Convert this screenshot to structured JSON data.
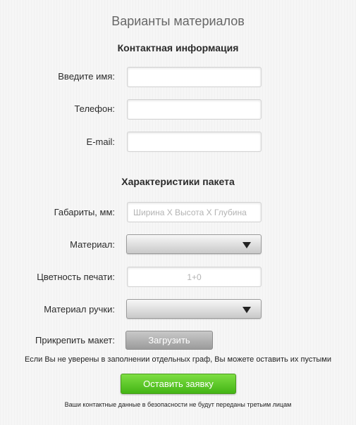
{
  "page": {
    "title": "Варианты материалов"
  },
  "contact": {
    "section_title": "Контактная информация",
    "name_label": "Введите имя:",
    "name_value": "",
    "phone_label": "Телефон:",
    "phone_value": "",
    "email_label": "E-mail:",
    "email_value": ""
  },
  "package": {
    "section_title": "Характеристики пакета",
    "dimensions_label": "Габариты, мм:",
    "dimensions_value": "",
    "dimensions_placeholder": "Ширина Х Высота Х Глубина",
    "material_label": "Материал:",
    "material_selected": "",
    "print_color_label": "Цветность печати:",
    "print_color_value": "",
    "print_color_placeholder": "1+0",
    "handle_material_label": "Материал ручки:",
    "handle_material_selected": "",
    "attach_label": "Прикрепить макет:",
    "upload_button": "Загрузить"
  },
  "notes": {
    "unsure_note": "Если Вы не уверены в заполнении отдельных граф, Вы можете оставить их пустыми",
    "privacy_note": "Ваши контактные данные в безопасности не будут переданы третьим лицам"
  },
  "actions": {
    "submit_button": "Оставить заявку"
  },
  "colors": {
    "submit_green_top": "#7ede43",
    "submit_green_bottom": "#43b515",
    "upload_gray_top": "#c9c9c9",
    "upload_gray_bottom": "#9b9b9b",
    "title_gray": "#666666"
  },
  "icons": {
    "select_arrow": "triangle-down-icon"
  }
}
